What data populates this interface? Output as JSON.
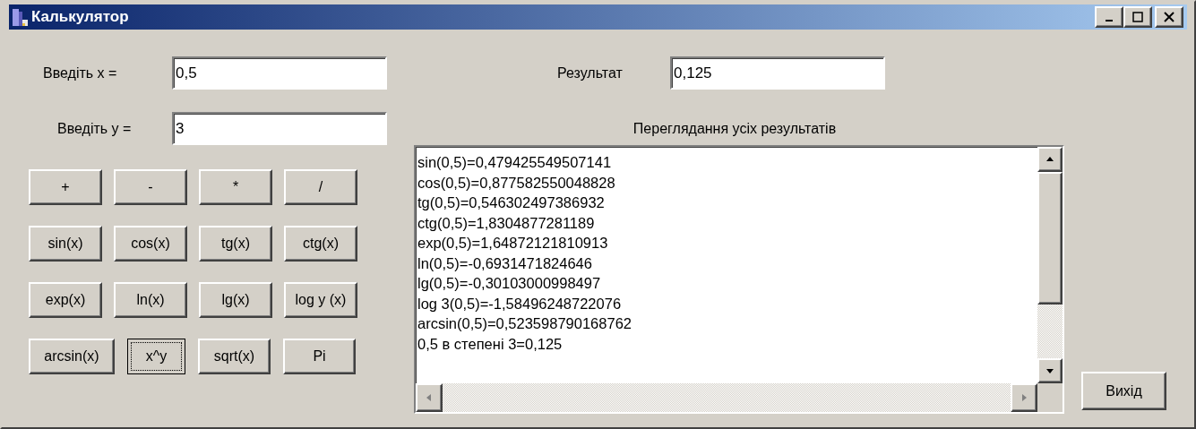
{
  "window": {
    "title": "Калькулятор"
  },
  "inputs": [
    {
      "label": "Введіть x =",
      "value": "0,5"
    },
    {
      "label": "Введіть y =",
      "value": "3"
    }
  ],
  "result": {
    "label": "Результат",
    "value": "0,125"
  },
  "buttons": [
    {
      "label": "+",
      "focused": false
    },
    {
      "label": "-",
      "focused": false
    },
    {
      "label": "*",
      "focused": false
    },
    {
      "label": "/",
      "focused": false
    },
    {
      "label": "sin(x)",
      "focused": false
    },
    {
      "label": "cos(x)",
      "focused": false
    },
    {
      "label": "tg(x)",
      "focused": false
    },
    {
      "label": "ctg(x)",
      "focused": false
    },
    {
      "label": "exp(x)",
      "focused": false
    },
    {
      "label": "ln(x)",
      "focused": false
    },
    {
      "label": "lg(x)",
      "focused": false
    },
    {
      "label": "log y (x)",
      "focused": false
    },
    {
      "label": "arcsin(x)",
      "focused": false
    },
    {
      "label": "x^y",
      "focused": true
    },
    {
      "label": "sqrt(x)",
      "focused": false
    },
    {
      "label": "Pi",
      "focused": false
    }
  ],
  "history": {
    "title": "Переглядання усіх результатів",
    "lines": [
      "sin(0,5)=0,479425549507141",
      "cos(0,5)=0,877582550048828",
      "tg(0,5)=0,546302497386932",
      "ctg(0,5)=1,8304877281189",
      "exp(0,5)=1,64872121810913",
      "ln(0,5)=-0,6931471824646",
      "lg(0,5)=-0,30103000998497",
      "log 3(0,5)=-1,58496248722076",
      "arcsin(0,5)=0,523598790168762",
      "0,5 в степені 3=0,125"
    ]
  },
  "exit_button": {
    "label": "Вихід"
  }
}
